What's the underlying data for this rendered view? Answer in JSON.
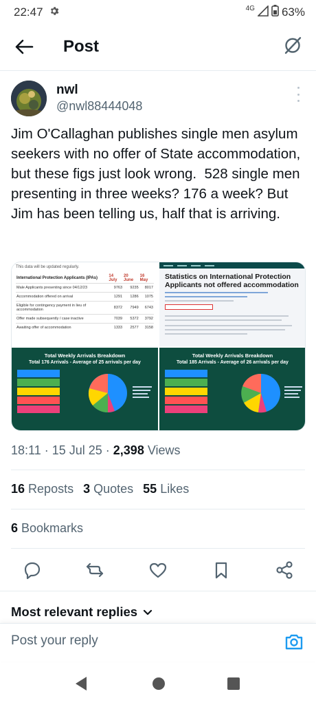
{
  "status_bar": {
    "time": "22:47",
    "network": "4G",
    "battery": "63%"
  },
  "header": {
    "title": "Post"
  },
  "author": {
    "name": "nwl",
    "handle": "@nwl88444048"
  },
  "tweet": {
    "text": "Jim O'Callaghan publishes single men asylum seekers with no offer of State accommodation, but these figs just look wrong.  528 single men presenting in three weeks? 176 a week? But Jim has been telling us, half that is arriving."
  },
  "media": {
    "table_image": {
      "note": "This data will be updated regularly.",
      "headers": [
        "International Protection Applicants (IPAs)",
        "14 July",
        "20 June",
        "16 May"
      ],
      "rows": [
        [
          "Male Applicants presenting since 04/12/23",
          "9763",
          "9235",
          "8017"
        ],
        [
          "Accommodation offered on arrival",
          "1291",
          "1286",
          "1075"
        ],
        [
          "Eligible for contingency payment in lieu of accommodation",
          "8372",
          "7949",
          "6743"
        ],
        [
          "Offer made subsequently / case inactive",
          "7039",
          "5372",
          "3792"
        ],
        [
          "Awaiting offer of accommodation",
          "1333",
          "2577",
          "3158"
        ]
      ]
    },
    "web_image": {
      "title": "Statistics on International Protection Applicants not offered accommodation"
    },
    "chart_left": {
      "title": "Total Weekly Arrivals Breakdown",
      "subtitle": "Total 176 Arrivals - Average of  25 arrivals per day"
    },
    "chart_right": {
      "title": "Total Weekly Arrivals Breakdown",
      "subtitle": "Total 185 Arrivals - Average of  26 arrivals per day"
    }
  },
  "meta": {
    "time": "18:11",
    "date": "15 Jul 25",
    "views_count": "2,398",
    "views_label": "Views"
  },
  "stats": {
    "reposts_count": "16",
    "reposts_label": "Reposts",
    "quotes_count": "3",
    "quotes_label": "Quotes",
    "likes_count": "55",
    "likes_label": "Likes",
    "bookmarks_count": "6",
    "bookmarks_label": "Bookmarks"
  },
  "replies": {
    "sort_label": "Most relevant replies"
  },
  "reply_bar": {
    "placeholder": "Post your reply"
  },
  "colors": {
    "accent": "#1d9bf0",
    "text": "#0f1419",
    "muted": "#536471",
    "chart_bg": "#0e4d3f"
  }
}
